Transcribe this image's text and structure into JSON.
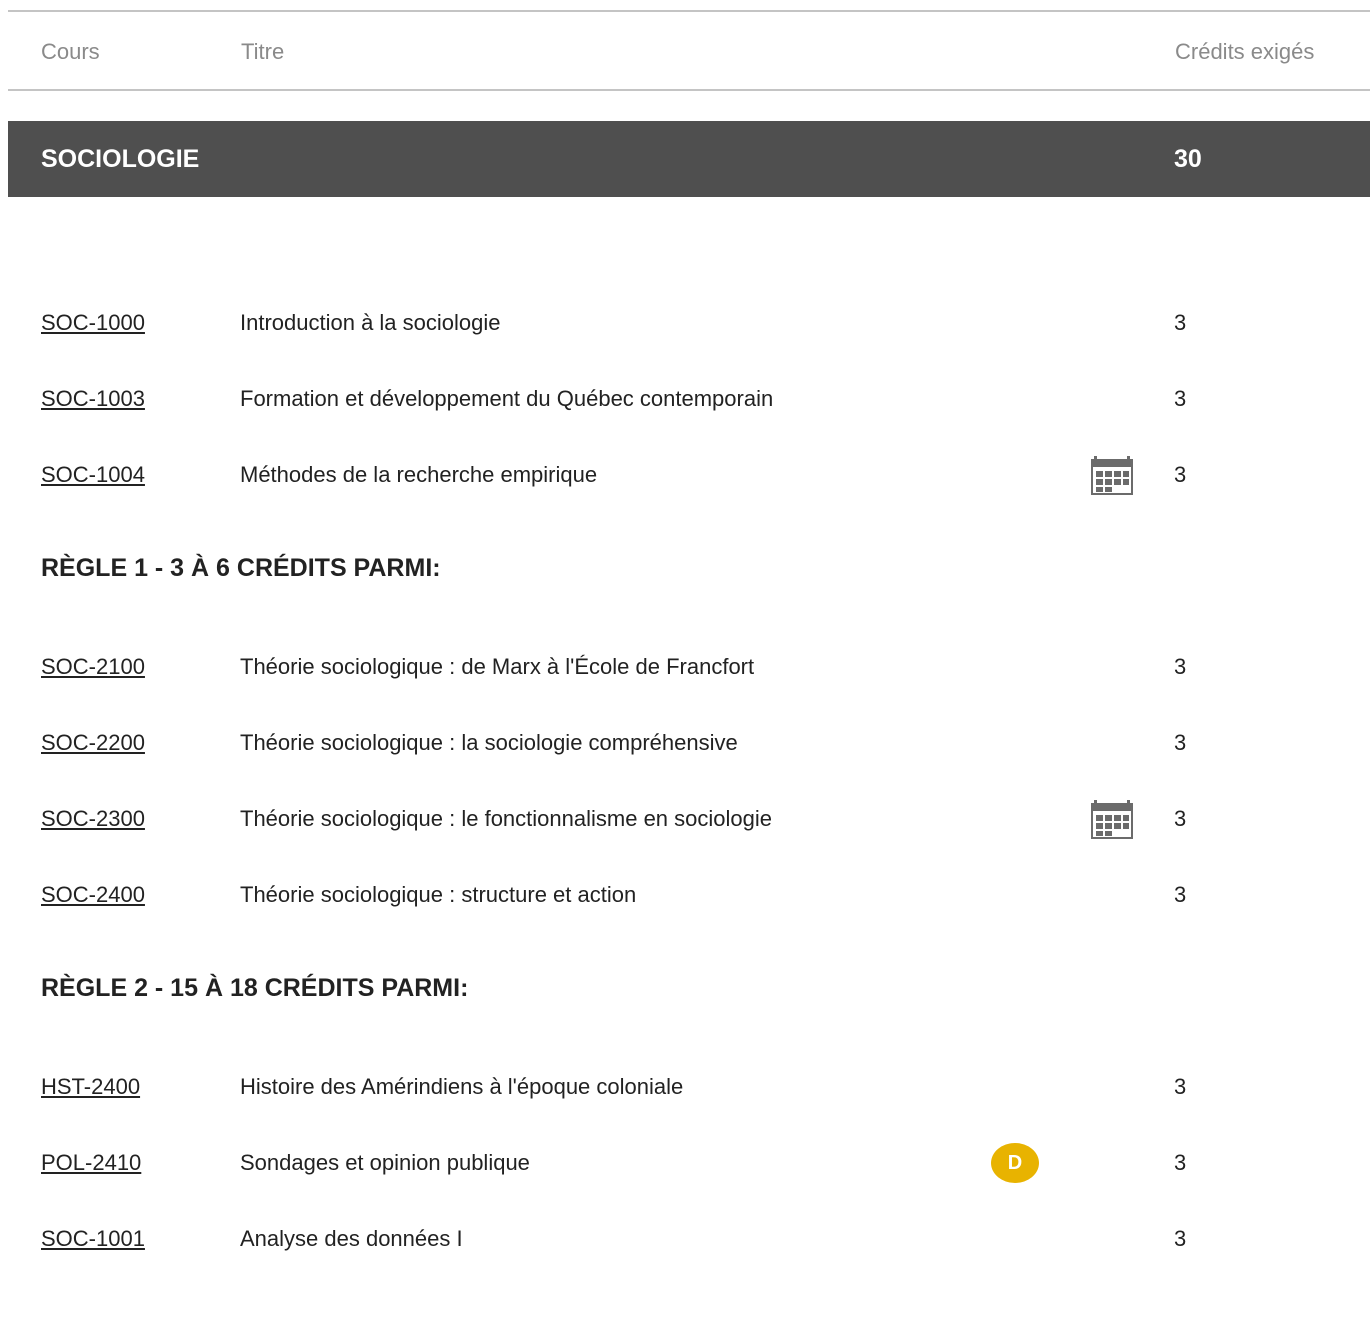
{
  "header": {
    "col_course": "Cours",
    "col_title": "Titre",
    "col_credits": "Crédits exigés"
  },
  "section": {
    "name": "SOCIOLOGIE",
    "credits": "30"
  },
  "groups": [
    {
      "rule": "",
      "courses": [
        {
          "code": "SOC-1000",
          "title": "Introduction à la sociologie",
          "credits": "3",
          "icon": null
        },
        {
          "code": "SOC-1003",
          "title": "Formation et développement du Québec contemporain",
          "credits": "3",
          "icon": null
        },
        {
          "code": "SOC-1004",
          "title": "Méthodes de la recherche empirique",
          "credits": "3",
          "icon": "calendar-icon"
        }
      ]
    },
    {
      "rule": "RÈGLE 1 - 3 À 6 CRÉDITS PARMI:",
      "courses": [
        {
          "code": "SOC-2100",
          "title": "Théorie sociologique : de Marx à l'École de Francfort",
          "credits": "3",
          "icon": null
        },
        {
          "code": "SOC-2200",
          "title": "Théorie sociologique : la sociologie compréhensive",
          "credits": "3",
          "icon": null
        },
        {
          "code": "SOC-2300",
          "title": "Théorie sociologique : le fonctionnalisme en sociologie",
          "credits": "3",
          "icon": "calendar-icon"
        },
        {
          "code": "SOC-2400",
          "title": "Théorie sociologique : structure et action",
          "credits": "3",
          "icon": null
        }
      ]
    },
    {
      "rule": "RÈGLE 2 - 15 À 18 CRÉDITS PARMI:",
      "courses": [
        {
          "code": "HST-2400",
          "title": "Histoire des Amérindiens à l'époque coloniale",
          "credits": "3",
          "icon": null
        },
        {
          "code": "POL-2410",
          "title": "Sondages et opinion publique",
          "credits": "3",
          "icon": "d-badge",
          "badge_text": "D"
        },
        {
          "code": "SOC-1001",
          "title": "Analyse des données I",
          "credits": "3",
          "icon": null
        }
      ]
    }
  ],
  "colors": {
    "section_bar": "#4f4f4f",
    "badge": "#e8b300",
    "header_text": "#8a8a8a"
  }
}
